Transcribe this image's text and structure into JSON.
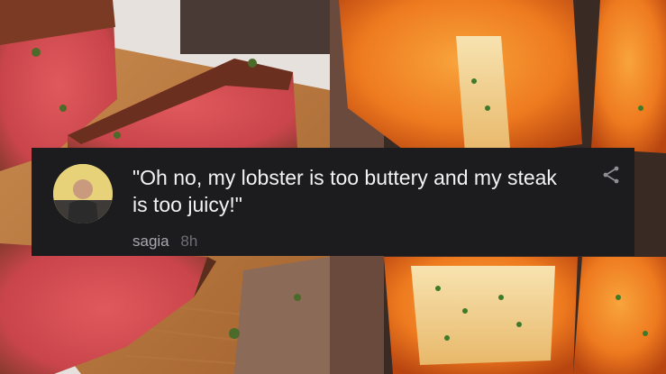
{
  "comment": {
    "text": "\"Oh no, my lobster is too buttery and my steak is too juicy!\"",
    "username": "sagia",
    "timestamp": "8h"
  },
  "icons": {
    "share": "share-icon",
    "avatar": "avatar"
  },
  "colors": {
    "card_background": "#1c1c1e",
    "comment_text": "#f2f2f2",
    "username": "#a9a9ad",
    "timestamp": "#6f6f74"
  }
}
